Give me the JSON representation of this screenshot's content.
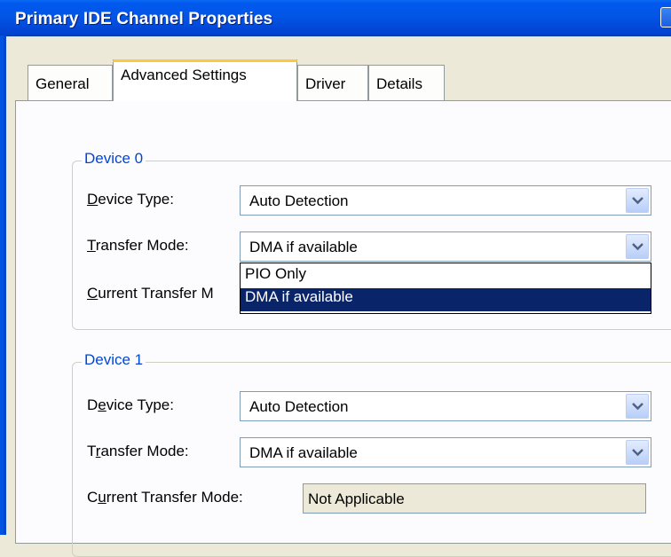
{
  "window": {
    "title": "Primary IDE Channel Properties"
  },
  "tabs": [
    {
      "label": "General",
      "active": false
    },
    {
      "label": "Advanced Settings",
      "active": true
    },
    {
      "label": "Driver",
      "active": false
    },
    {
      "label": "Details",
      "active": false
    }
  ],
  "device0": {
    "group_title": "Device 0",
    "device_type_label_u": "D",
    "device_type_label_rest": "evice Type:",
    "device_type_value": "Auto Detection",
    "transfer_mode_label_u": "T",
    "transfer_mode_label_rest": "ransfer Mode:",
    "transfer_mode_value": "DMA if available",
    "current_label_u": "C",
    "current_label_rest": "urrent Transfer M",
    "dropdown_options": [
      "PIO Only",
      "DMA if available"
    ],
    "dropdown_selected": "DMA if available"
  },
  "device1": {
    "group_title": "Device 1",
    "device_type_label_pre": "D",
    "device_type_label_u": "e",
    "device_type_label_rest": "vice Type:",
    "device_type_value": "Auto Detection",
    "transfer_mode_label_pre": "T",
    "transfer_mode_label_u": "r",
    "transfer_mode_label_rest": "ansfer Mode:",
    "transfer_mode_value": "DMA if available",
    "current_label_pre": "C",
    "current_label_u": "u",
    "current_label_rest": "rrent Transfer Mode:",
    "current_value": "Not Applicable"
  },
  "colors": {
    "title_bar": "#0245d6",
    "group_title": "#0046d5",
    "selection": "#0a246a",
    "tab_highlight": "#ffc83c"
  },
  "icons": {
    "combo_arrow": "chevron-down-icon"
  }
}
